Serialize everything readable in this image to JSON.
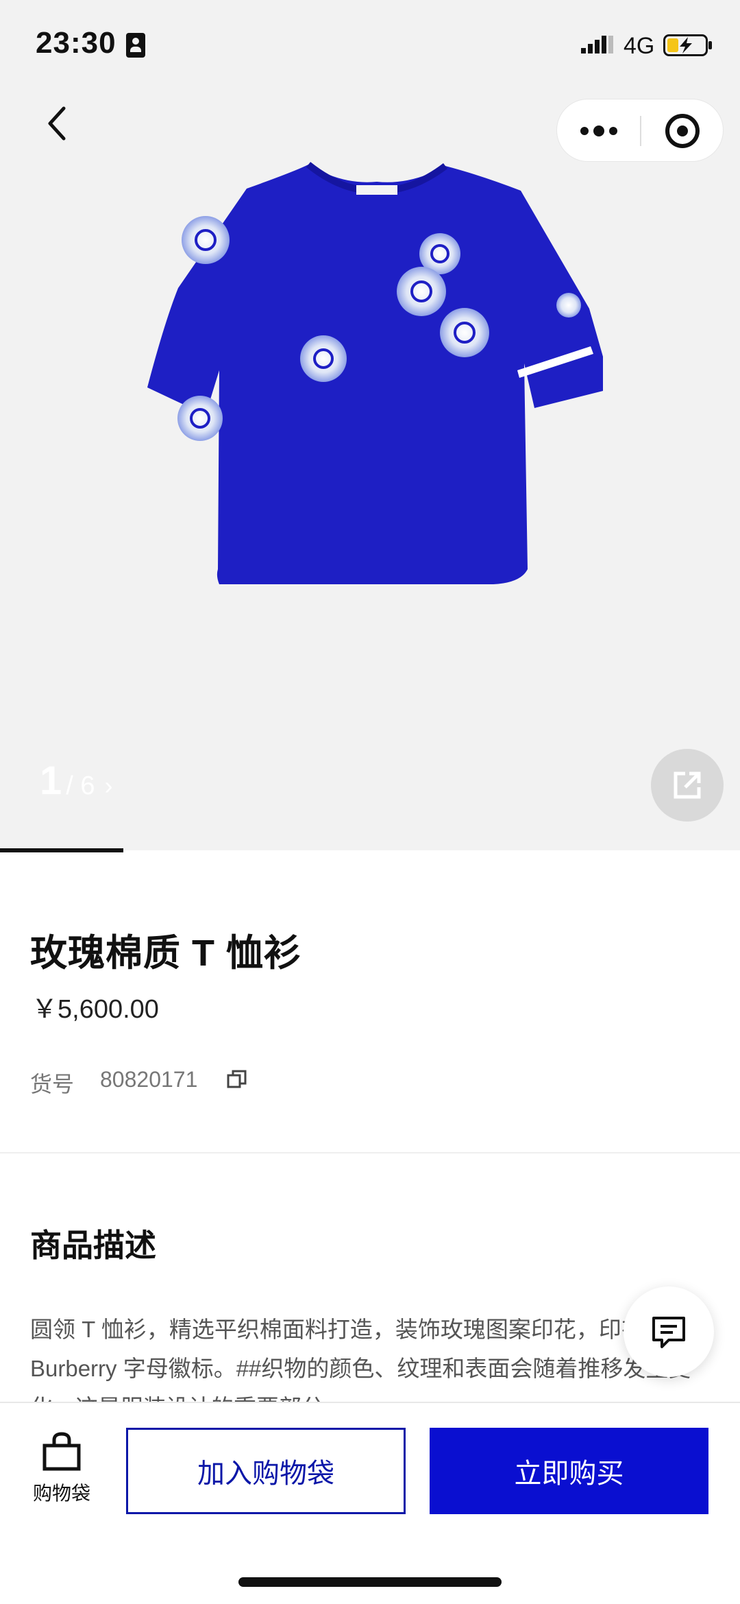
{
  "status_bar": {
    "time": "23:30",
    "network": "4G",
    "icons": [
      "id-card-icon",
      "signal-icon",
      "battery-charging-icon"
    ]
  },
  "nav": {
    "icons": [
      "back-chevron-icon",
      "more-dots-icon",
      "close-target-icon"
    ]
  },
  "gallery": {
    "current": "1",
    "total": "/ 6",
    "arrow": "›",
    "progress": 0.167,
    "share_icon": "share-external-icon",
    "image_colors": {
      "shirt": "#1e1fc4",
      "print": "#e8ecf5",
      "background": "#f2f2f2"
    }
  },
  "product": {
    "title": "玫瑰棉质 T 恤衫",
    "price": "￥5,600.00",
    "sku_label": "货号",
    "sku_value": "80820171",
    "copy_icon": "copy-icon"
  },
  "description": {
    "heading": "商品描述",
    "text": "圆领 T 恤衫，精选平织棉面料打造，装饰玫瑰图案印花，印有 Burberry 字母徽标。##织物的颜色、纹理和表面会随着推移发生变化，这是服装设计的重要部分"
  },
  "chat": {
    "icon": "chat-message-icon"
  },
  "bottom_bar": {
    "bag_label": "购物袋",
    "bag_icon": "shopping-bag-icon",
    "add_to_bag": "加入购物袋",
    "buy_now": "立即购买",
    "accent": "#0a0fd0"
  }
}
